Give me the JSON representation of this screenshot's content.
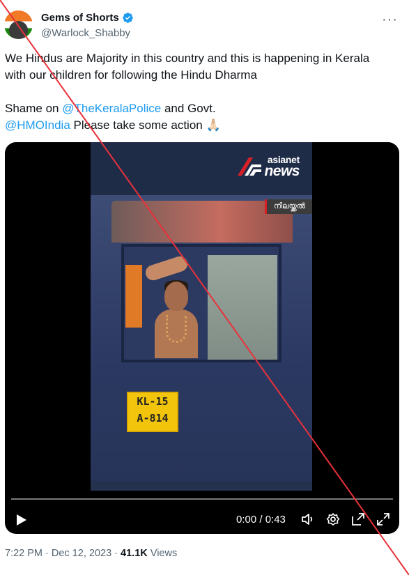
{
  "author": {
    "display_name": "Gems of Shorts",
    "handle": "@Warlock_Shabby",
    "verified": true,
    "avatar_icon": "avatar-flag"
  },
  "more_icon": "more-dots-icon",
  "tweet": {
    "line1": "We Hindus are Majority in this country and this is happening in Kerala",
    "line2": "with our children for following the Hindu Dharma",
    "shame_prefix": "Shame on ",
    "mention1": "@TheKeralaPolice",
    "shame_suffix": " and Govt.",
    "mention2": "@HMOIndia",
    "action_text": " Please take some action 🙏🏻"
  },
  "video": {
    "channel_logo_line1": "asianet",
    "channel_logo_line2": "news",
    "location_tag": "നിലയ്ക്കൽ",
    "plate_line1": "KL-15",
    "plate_line2": "A-814",
    "time_display": "0:00 / 0:43",
    "progress": 0.0,
    "icons": [
      "play-icon",
      "volume-icon",
      "settings-icon",
      "popout-icon",
      "fullscreen-icon"
    ]
  },
  "meta": {
    "time": "7:22 PM",
    "separator1": " · ",
    "date": "Dec 12, 2023",
    "separator2": " · ",
    "views_count": "41.1K",
    "views_label": " Views"
  },
  "overlay": {
    "strike_color": "#e8313a"
  }
}
